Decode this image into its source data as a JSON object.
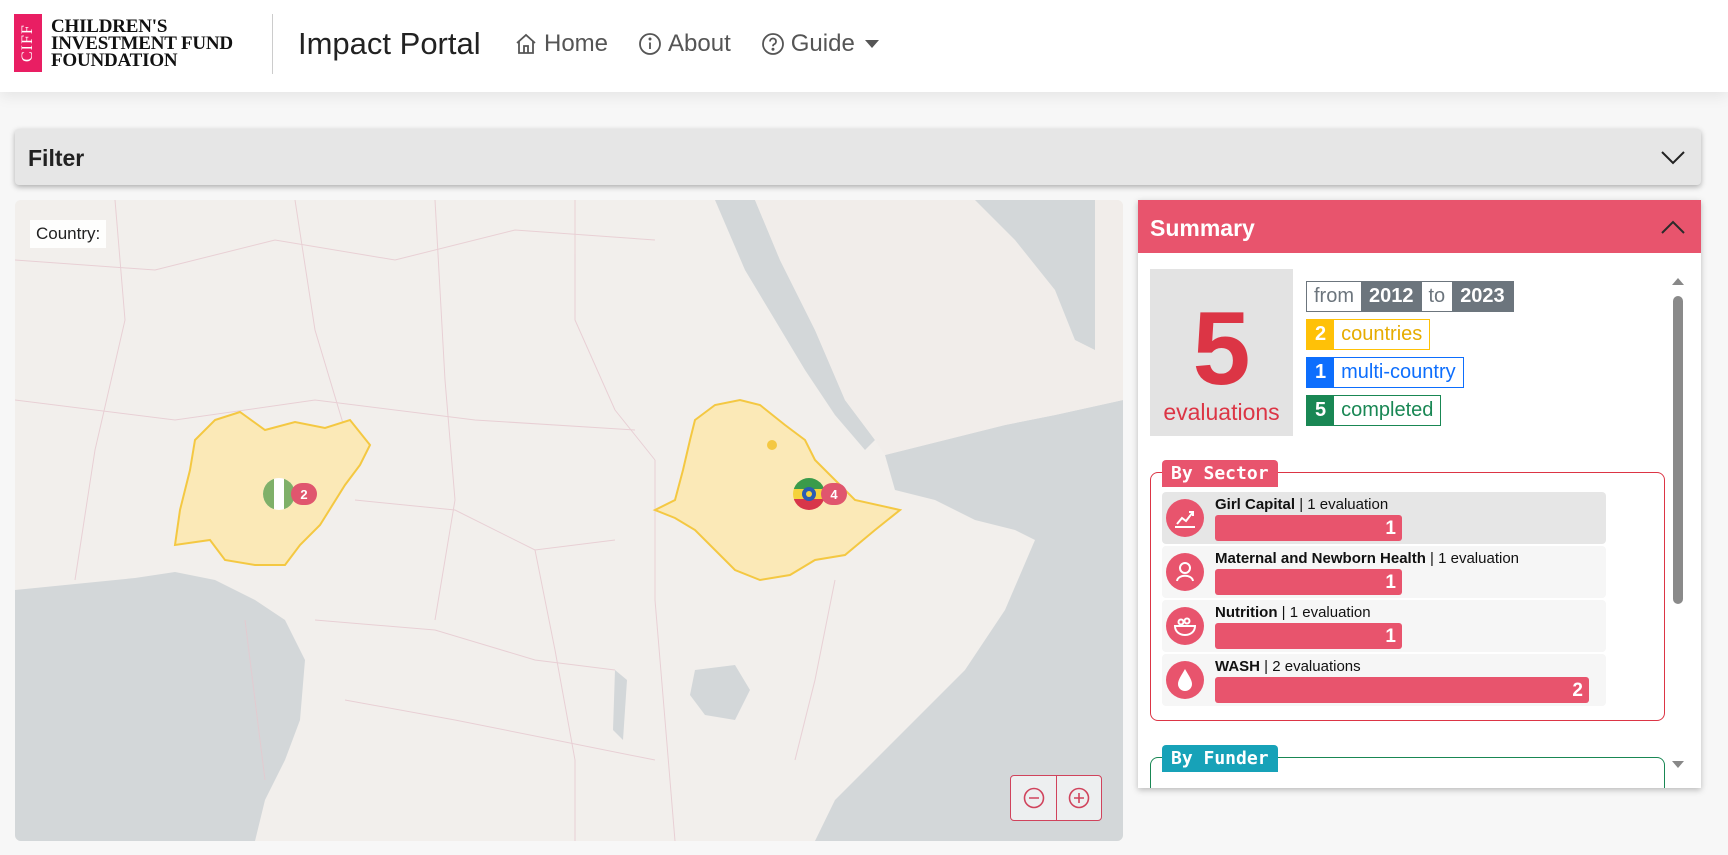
{
  "header": {
    "logo_mark": "CIFF",
    "logo_lines": [
      "CHILDREN'S",
      "INVESTMENT FUND",
      "FOUNDATION"
    ],
    "brand": "Impact Portal",
    "nav": [
      {
        "label": "Home",
        "icon": "home-icon"
      },
      {
        "label": "About",
        "icon": "info-icon"
      },
      {
        "label": "Guide",
        "icon": "question-icon"
      }
    ]
  },
  "filter": {
    "title": "Filter"
  },
  "map": {
    "country_label": "Country:",
    "markers": [
      {
        "country": "Nigeria",
        "count": "2"
      },
      {
        "country": "Ethiopia",
        "count": "4"
      }
    ],
    "highlight_color": "#fbe9b7"
  },
  "summary": {
    "title": "Summary",
    "total": "5",
    "total_label": "evaluations",
    "from_label": "from",
    "from_year": "2012",
    "to_label": "to",
    "to_year": "2023",
    "countries_count": "2",
    "countries_label": "countries",
    "multi_count": "1",
    "multi_label": "multi-country",
    "completed_count": "5",
    "completed_label": "completed",
    "by_sector_title": "By Sector",
    "sectors": [
      {
        "name": "Girl Capital",
        "detail": " | 1 evaluation",
        "value": 1
      },
      {
        "name": "Maternal and Newborn Health",
        "detail": " | 1 evaluation",
        "value": 1
      },
      {
        "name": "Nutrition",
        "detail": " | 1 evaluation",
        "value": 1
      },
      {
        "name": "WASH",
        "detail": " | 2 evaluations",
        "value": 2
      }
    ],
    "sector_bar_max": 2,
    "by_funder_title": "By Funder"
  },
  "colors": {
    "accent": "#e8546d",
    "countries": "#ffc107",
    "multi": "#0d6efd",
    "completed": "#198754",
    "years": "#6c757d",
    "funder": "#17a2b8"
  }
}
